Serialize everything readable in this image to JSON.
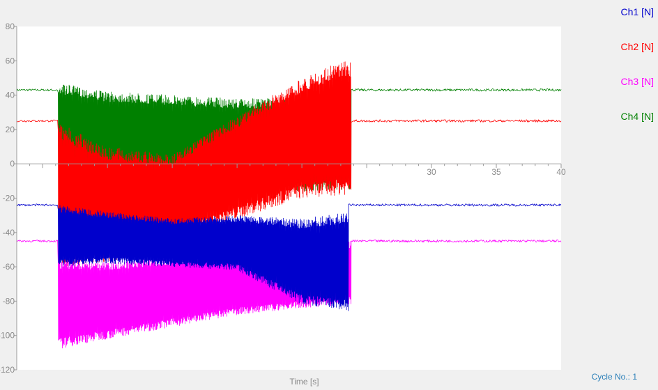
{
  "chart_data": {
    "type": "line",
    "xlabel": "Time [s]",
    "ylabel": "",
    "xlim": [
      -2,
      40
    ],
    "ylim": [
      -120,
      80
    ],
    "x_ticks": [
      30,
      35,
      40
    ],
    "y_ticks": [
      80,
      60,
      40,
      20,
      0,
      -20,
      -40,
      -60,
      -80,
      -100,
      -120
    ],
    "grid": false,
    "legend_position": "right",
    "series": [
      {
        "name": "Ch1 [N]",
        "color": "#0000cc",
        "baseline": -24,
        "active_start": 1.2,
        "active_end": 23.6,
        "envelope": [
          {
            "x": 1.2,
            "min": -60,
            "max": -24
          },
          {
            "x": 5,
            "min": -58,
            "max": -28
          },
          {
            "x": 10,
            "min": -60,
            "max": -32
          },
          {
            "x": 15,
            "min": -62,
            "max": -30
          },
          {
            "x": 20,
            "min": -82,
            "max": -32
          },
          {
            "x": 23.4,
            "min": -86,
            "max": -28
          }
        ]
      },
      {
        "name": "Ch2 [N]",
        "color": "#ff0000",
        "baseline": 25,
        "active_start": 1.2,
        "active_end": 23.8,
        "envelope": [
          {
            "x": 1.2,
            "min": -60,
            "max": 24
          },
          {
            "x": 5,
            "min": -58,
            "max": 10
          },
          {
            "x": 10,
            "min": -45,
            "max": 5
          },
          {
            "x": 15,
            "min": -32,
            "max": 28
          },
          {
            "x": 20,
            "min": -20,
            "max": 50
          },
          {
            "x": 23.2,
            "min": -18,
            "max": 60
          }
        ]
      },
      {
        "name": "Ch3 [N]",
        "color": "#ff00ff",
        "baseline": -45,
        "active_start": 1.2,
        "active_end": 23.8,
        "envelope": [
          {
            "x": 1.2,
            "min": -108,
            "max": -55
          },
          {
            "x": 5,
            "min": -102,
            "max": -57
          },
          {
            "x": 10,
            "min": -95,
            "max": -54
          },
          {
            "x": 15,
            "min": -88,
            "max": -52
          },
          {
            "x": 20,
            "min": -84,
            "max": -50
          },
          {
            "x": 23.6,
            "min": -82,
            "max": -45
          }
        ]
      },
      {
        "name": "Ch4 [N]",
        "color": "#008000",
        "baseline": 43,
        "active_start": 1.2,
        "active_end": 23.8,
        "envelope": [
          {
            "x": 1.2,
            "min": -5,
            "max": 47
          },
          {
            "x": 5,
            "min": -8,
            "max": 42
          },
          {
            "x": 10,
            "min": -10,
            "max": 40
          },
          {
            "x": 15,
            "min": -12,
            "max": 38
          },
          {
            "x": 20,
            "min": -16,
            "max": 38
          },
          {
            "x": 23.6,
            "min": -15,
            "max": 42
          }
        ]
      }
    ]
  },
  "footer": {
    "cycle_label": "Cycle No.:",
    "cycle_value": "1"
  }
}
